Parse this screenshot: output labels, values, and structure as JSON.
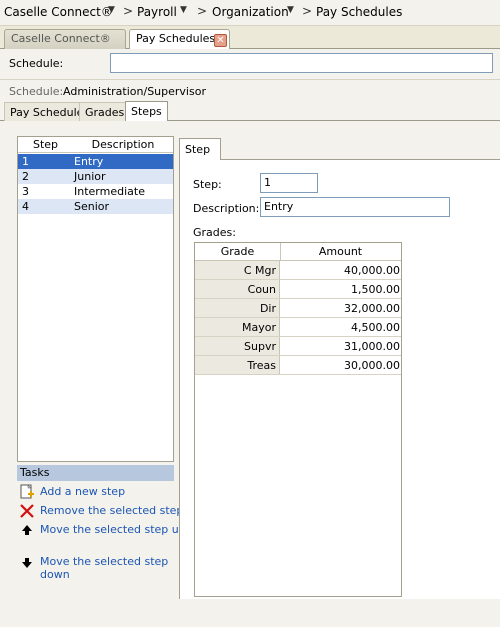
{
  "breadcrumb": {
    "items": [
      "Caselle Connect®",
      "Payroll",
      "Organization",
      "Pay Schedules"
    ],
    "separator": ">"
  },
  "doc_tabs": [
    {
      "label": "Caselle Connect®",
      "active": false
    },
    {
      "label": "Pay Schedules",
      "active": true
    }
  ],
  "schedule_field": {
    "label": "Schedule:",
    "value": ""
  },
  "schedule_info": {
    "label": "Schedule:",
    "value": "Administration/Supervisor"
  },
  "sub_tabs": [
    {
      "label": "Pay Schedule",
      "active": false
    },
    {
      "label": "Grades",
      "active": false
    },
    {
      "label": "Steps",
      "active": true
    }
  ],
  "steps_list": {
    "columns": [
      "Step",
      "Description"
    ],
    "rows": [
      {
        "step": "1",
        "description": "Entry",
        "selected": true
      },
      {
        "step": "2",
        "description": "Junior",
        "selected": false
      },
      {
        "step": "3",
        "description": "Intermediate",
        "selected": false
      },
      {
        "step": "4",
        "description": "Senior",
        "selected": false
      }
    ]
  },
  "tasks": {
    "title": "Tasks",
    "items": [
      {
        "label": "Add a new step",
        "icon": "add-step-icon"
      },
      {
        "label": "Remove the selected step",
        "icon": "remove-x-icon"
      },
      {
        "label": "Move the selected step up",
        "icon": "arrow-up-icon"
      },
      {
        "label": "Move the selected step down",
        "icon": "arrow-down-icon"
      }
    ]
  },
  "step_panel": {
    "tab_label": "Step",
    "step_label": "Step:",
    "step_value": "1",
    "description_label": "Description:",
    "description_value": "Entry",
    "grades_label": "Grades:"
  },
  "grades_grid": {
    "columns": [
      "Grade",
      "Amount"
    ],
    "rows": [
      {
        "grade": "C Mgr",
        "amount": "40,000.00"
      },
      {
        "grade": "Coun",
        "amount": "1,500.00"
      },
      {
        "grade": "Dir",
        "amount": "32,000.00"
      },
      {
        "grade": "Mayor",
        "amount": "4,500.00"
      },
      {
        "grade": "Supvr",
        "amount": "31,000.00"
      },
      {
        "grade": "Treas",
        "amount": "30,000.00"
      }
    ]
  },
  "colors": {
    "selection": "#316ac5",
    "alt_row": "#dde6f4",
    "task_link": "#1c55b4",
    "tasks_header": "#b7c7de"
  }
}
